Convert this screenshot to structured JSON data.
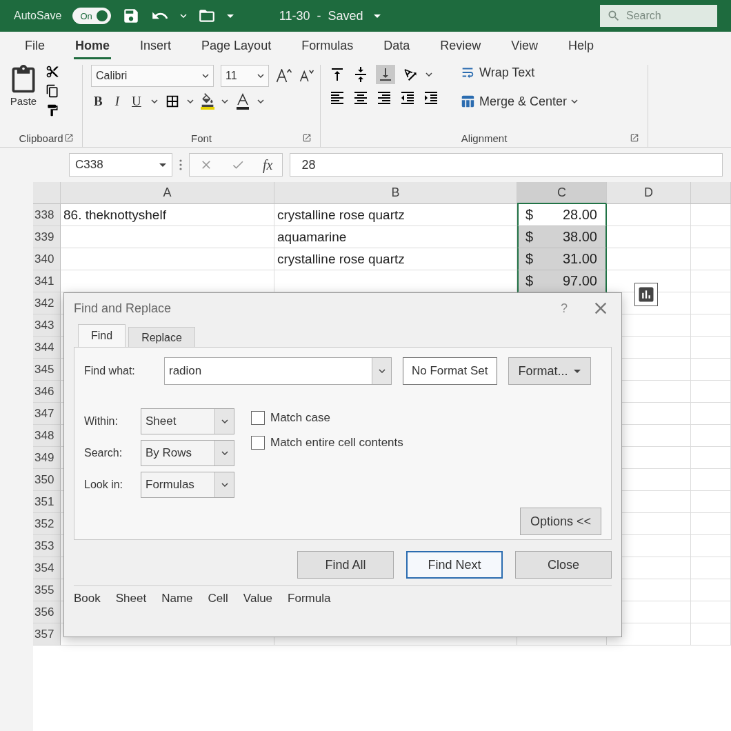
{
  "title_bar": {
    "autosave": {
      "label": "AutoSave",
      "state": "On",
      "on": true
    },
    "title": "11-30  -  Saved",
    "search": {
      "placeholder": "Search"
    }
  },
  "tabs": [
    {
      "label": "File",
      "selected": false
    },
    {
      "label": "Home",
      "selected": true
    },
    {
      "label": "Insert",
      "selected": false
    },
    {
      "label": "Page Layout",
      "selected": false
    },
    {
      "label": "Formulas",
      "selected": false
    },
    {
      "label": "Data",
      "selected": false
    },
    {
      "label": "Review",
      "selected": false
    },
    {
      "label": "View",
      "selected": false
    },
    {
      "label": "Help",
      "selected": false
    }
  ],
  "ribbon": {
    "clipboard": {
      "paste": "Paste",
      "group": "Clipboard"
    },
    "font": {
      "name": "Calibri",
      "size": "11",
      "bold": "B",
      "italic": "I",
      "underline": "U",
      "group": "Font"
    },
    "alignment": {
      "wrap": "Wrap Text",
      "merge": "Merge & Center",
      "group": "Alignment"
    }
  },
  "formula_bar": {
    "name_box": "C338",
    "fx": "fx",
    "value": "28"
  },
  "sheet": {
    "columns": [
      {
        "label": "A",
        "selected": false
      },
      {
        "label": "B",
        "selected": false
      },
      {
        "label": "C",
        "selected": true
      },
      {
        "label": "D",
        "selected": false
      }
    ],
    "rows": [
      {
        "number": "338",
        "a": "86. theknottyshelf",
        "b": "crystalline rose quartz",
        "currency": "$",
        "amount": "28.00",
        "selected": true,
        "active": true
      },
      {
        "number": "339",
        "b": "aquamarine",
        "currency": "$",
        "amount": "38.00",
        "selected": true,
        "active": false
      },
      {
        "number": "340",
        "b": "crystalline rose quartz",
        "currency": "$",
        "amount": "31.00",
        "selected": true,
        "active": false
      },
      {
        "number": "341",
        "currency": "$",
        "amount": "97.00",
        "selected": true,
        "active": false
      },
      {
        "number": "342"
      },
      {
        "number": "343"
      },
      {
        "number": "344"
      },
      {
        "number": "345"
      },
      {
        "number": "346"
      },
      {
        "number": "347"
      },
      {
        "number": "348"
      },
      {
        "number": "349"
      },
      {
        "number": "350"
      },
      {
        "number": "351"
      },
      {
        "number": "352"
      },
      {
        "number": "353"
      },
      {
        "number": "354"
      },
      {
        "number": "355"
      },
      {
        "number": "356"
      },
      {
        "number": "357"
      }
    ]
  },
  "dialog": {
    "title": "Find and Replace",
    "help": "?",
    "tabs": [
      {
        "label": "Find",
        "selected": true
      },
      {
        "label": "Replace",
        "selected": false
      }
    ],
    "find_what": {
      "label": "Find what:",
      "value": "radion"
    },
    "format_status": "No Format Set",
    "format_button": "Format...",
    "options": [
      {
        "label": "Within:",
        "value": "Sheet"
      },
      {
        "label": "Search:",
        "value": "By Rows"
      },
      {
        "label": "Look in:",
        "value": "Formulas"
      }
    ],
    "checkboxes": [
      {
        "label": "Match case",
        "checked": false
      },
      {
        "label": "Match entire cell contents",
        "checked": false
      }
    ],
    "options_button": "Options <<",
    "buttons": [
      {
        "label": "Find All",
        "default": false
      },
      {
        "label": "Find Next",
        "default": true
      },
      {
        "label": "Close",
        "default": false
      }
    ],
    "result_columns": [
      "Book",
      "Sheet",
      "Name",
      "Cell",
      "Value",
      "Formula"
    ]
  }
}
